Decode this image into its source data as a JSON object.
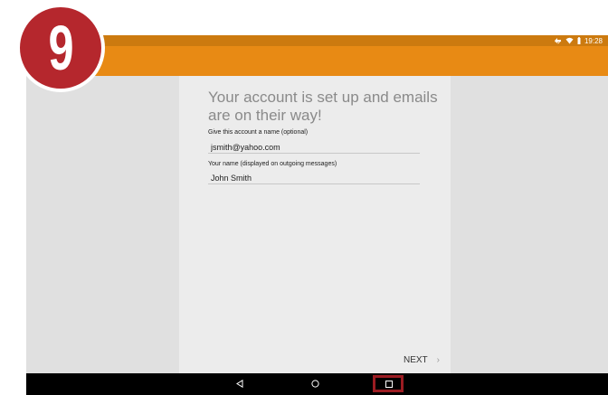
{
  "colors": {
    "status_bar": "#cc7a0f",
    "app_bar": "#e88a14",
    "background": "#e0e0e0",
    "card": "#ececec",
    "nav_bar": "#000000",
    "highlight": "#9c1c22",
    "badge": "#b5272d"
  },
  "badge": {
    "step_number": "9"
  },
  "status_bar": {
    "time": "19:28",
    "icons": [
      "sync-icon",
      "wifi-icon",
      "battery-icon"
    ]
  },
  "setup": {
    "headline": "Your account is set up and emails are on their way!",
    "account_name_label": "Give this account a name (optional)",
    "account_name_value": "jsmith@yahoo.com",
    "your_name_label": "Your name (displayed on outgoing messages)",
    "your_name_value": "John Smith",
    "next_label": "NEXT",
    "next_chevron": "›"
  },
  "nav_bar": {
    "buttons": [
      "back-icon",
      "home-icon",
      "recents-icon"
    ],
    "highlighted": "recents-icon"
  }
}
